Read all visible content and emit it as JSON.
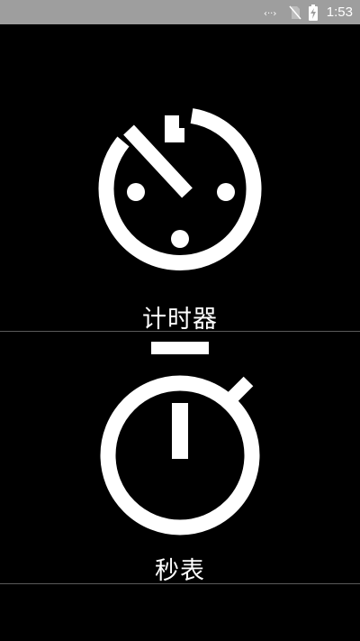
{
  "status_bar": {
    "time": "1:53",
    "icons": [
      "data-transfer-icon",
      "no-sim-icon",
      "battery-charging-icon"
    ]
  },
  "timer": {
    "label": "计时器",
    "icon": "timer-icon"
  },
  "stopwatch": {
    "label": "秒表",
    "icon": "stopwatch-icon"
  },
  "colors": {
    "background": "#000000",
    "status_bar": "#9e9e9e",
    "foreground": "#ffffff",
    "divider": "#5a5a5a"
  }
}
